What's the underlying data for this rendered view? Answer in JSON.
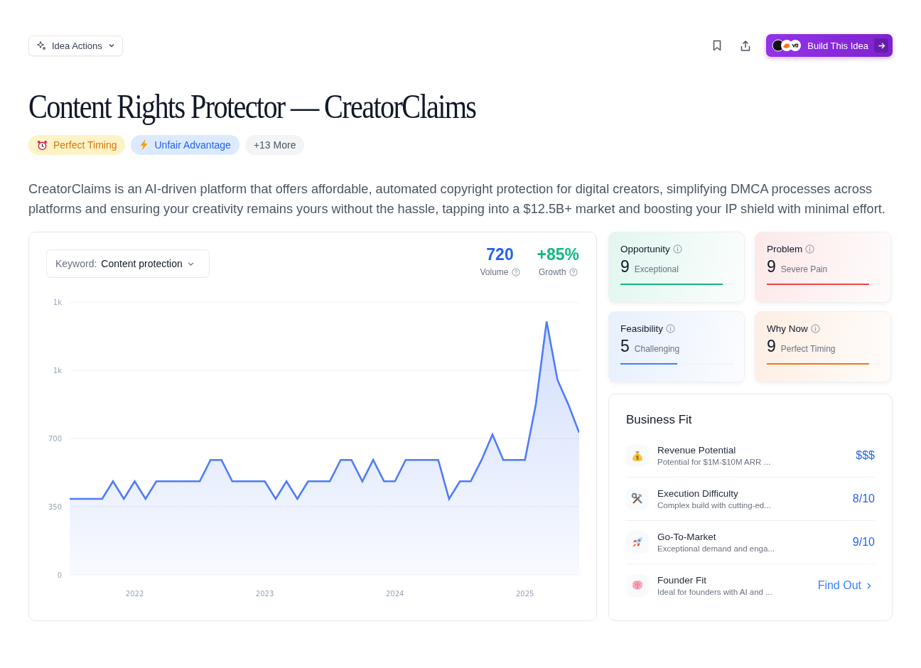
{
  "toolbar": {
    "actions_label": "Idea Actions",
    "build_label": "Build This Idea"
  },
  "title": "Content Rights Protector — CreatorClaims",
  "tags": [
    {
      "label": "Perfect Timing",
      "kind": "timing"
    },
    {
      "label": "Unfair Advantage",
      "kind": "advantage"
    },
    {
      "label": "+13 More",
      "kind": "more"
    }
  ],
  "description": "CreatorClaims is an AI-driven platform that offers affordable, automated copyright protection for digital creators, simplifying DMCA processes across platforms and ensuring your creativity remains yours without the hassle, tapping into a $12.5B+ market and boosting your IP shield with minimal effort.",
  "trend": {
    "keyword_label": "Keyword:",
    "keyword": "Content protection",
    "stats": [
      {
        "value": "720",
        "label": "Volume",
        "color": "#2563eb"
      },
      {
        "value": "+85%",
        "label": "Growth",
        "color": "#10b981"
      }
    ],
    "chart_data": {
      "type": "area",
      "categories": [
        null,
        null,
        null,
        null,
        null,
        null,
        "2022",
        null,
        null,
        null,
        null,
        null,
        null,
        null,
        null,
        null,
        null,
        null,
        "2023",
        null,
        null,
        null,
        null,
        null,
        null,
        null,
        null,
        null,
        null,
        null,
        "2024",
        null,
        null,
        null,
        null,
        null,
        null,
        null,
        null,
        null,
        null,
        null,
        "2025",
        null,
        null,
        null,
        null,
        null
      ],
      "series": [
        {
          "color": "#4f7cf6",
          "values": [
            390,
            390,
            390,
            390,
            480,
            390,
            480,
            390,
            480,
            480,
            480,
            480,
            480,
            590,
            590,
            480,
            480,
            480,
            480,
            390,
            480,
            390,
            480,
            480,
            480,
            590,
            590,
            480,
            590,
            480,
            480,
            590,
            590,
            590,
            590,
            390,
            480,
            480,
            590,
            720,
            590,
            590,
            590,
            875,
            1300,
            1000,
            875,
            730
          ]
        }
      ],
      "ylim": [
        0,
        1400
      ],
      "grid": true,
      "yticks": [
        {
          "value": 0,
          "label": "0"
        },
        {
          "value": 350,
          "label": "350"
        },
        {
          "value": 700,
          "label": "700"
        },
        {
          "value": 1050,
          "label": "1k"
        },
        {
          "value": 1400,
          "label": "1k"
        }
      ]
    }
  },
  "scores": [
    {
      "label": "Opportunity",
      "score": "9",
      "rating": "Exceptional",
      "level": 0.9,
      "color": "#10b981"
    },
    {
      "label": "Problem",
      "score": "9",
      "rating": "Severe Pain",
      "level": 0.9,
      "color": "#ef4444"
    },
    {
      "label": "Feasibility",
      "score": "5",
      "rating": "Challenging",
      "level": 0.5,
      "color": "#3b82f6"
    },
    {
      "label": "Why Now",
      "score": "9",
      "rating": "Perfect Timing",
      "level": 0.9,
      "color": "#f97316"
    }
  ],
  "business_fit": {
    "title": "Business Fit",
    "items": [
      {
        "kind": "revenue",
        "title": "Revenue Potential",
        "subtitle": "Potential for $1M-$10M ARR ...",
        "value": "$$$"
      },
      {
        "kind": "execution",
        "title": "Execution Difficulty",
        "subtitle": "Complex build with cutting-ed...",
        "value": "8/10"
      },
      {
        "kind": "market",
        "title": "Go-To-Market",
        "subtitle": "Exceptional demand and enga...",
        "value": "9/10"
      },
      {
        "kind": "founder",
        "title": "Founder Fit",
        "subtitle": "Ideal for founders with AI and ...",
        "link": "Find Out"
      }
    ]
  }
}
